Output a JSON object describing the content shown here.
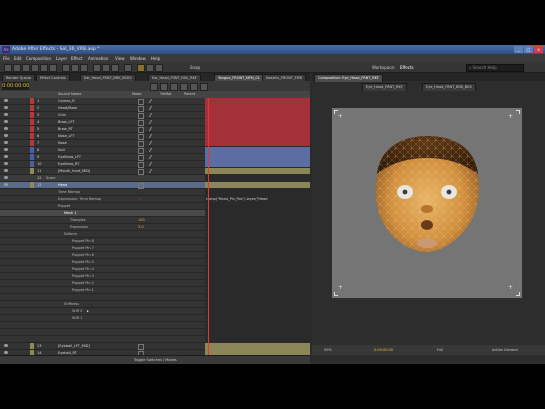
{
  "window": {
    "title": "Adobe After Effects - Sol_36_VRB.aep *"
  },
  "menu": [
    "File",
    "Edit",
    "Composition",
    "Layer",
    "Effect",
    "Animation",
    "View",
    "Window",
    "Help"
  ],
  "toolbar": {
    "snapping_label": "Snap",
    "workspace_label": "Workspace:",
    "workspace_value": "Effects",
    "search_placeholder": "Search Help"
  },
  "timeline": {
    "tabs": [
      "Render Queue",
      "Effect Controls",
      "Ear_Head_FRNT_BRK_BCKS",
      "Ear_Head_FRNT_RHL_RKF",
      "Tongue_FRONT_MFN_01",
      "Nostrils_FRONT_FMR"
    ],
    "timecode": "0:00:00:00",
    "columns": {
      "source_name": "Source Name",
      "mode": "Mode",
      "track": "TrkMat",
      "parent": "Parent"
    },
    "layers": [
      {
        "num": "1",
        "name": "Cornea_R"
      },
      {
        "num": "2",
        "name": "Head/Mask"
      },
      {
        "num": "3",
        "name": "Chin"
      },
      {
        "num": "4",
        "name": "Brow_LFT"
      },
      {
        "num": "5",
        "name": "Brow_RT"
      },
      {
        "num": "6",
        "name": "Nose_LFT"
      },
      {
        "num": "7",
        "name": "Nose"
      },
      {
        "num": "8",
        "name": "Null"
      },
      {
        "num": "9",
        "name": "EyeBrow_LFT"
      },
      {
        "num": "10",
        "name": "EyeBrow_RT"
      },
      {
        "num": "11",
        "name": "[Mouth_front_MID]"
      },
      {
        "num": "12",
        "name": "Head"
      }
    ],
    "properties": [
      {
        "label": "Scale"
      },
      {
        "label": "Time Remap"
      },
      {
        "label": "Expression: Time Remap"
      },
      {
        "label": "Puppet"
      },
      {
        "label": "Mesh 1"
      },
      {
        "label": "Triangles",
        "value": "100"
      },
      {
        "label": "Expansion",
        "value": "3.0"
      },
      {
        "label": "Deform"
      },
      {
        "label": "Puppet Pin 8"
      },
      {
        "label": "Puppet Pin 7"
      },
      {
        "label": "Puppet Pin 6"
      },
      {
        "label": "Puppet Pin 5"
      },
      {
        "label": "Puppet Pin 4"
      },
      {
        "label": "Puppet Pin 3"
      },
      {
        "label": "Puppet Pin 2"
      },
      {
        "label": "Puppet Pin 1"
      },
      {
        "label": "Stiffness"
      },
      {
        "label": "Stiff 2"
      },
      {
        "label": "Stiff 1"
      }
    ],
    "bottom_layers": [
      {
        "num": "13",
        "name": "[Eyeball_LFT_MID]"
      },
      {
        "num": "14",
        "name": "Eyeball_RT"
      }
    ],
    "expression_text": "comp(\"Head_Pin_Pos\").layer(\"Head",
    "footer_label": "Toggle Switches / Modes"
  },
  "viewer": {
    "tab": "Composition: Eye_Head_FRNT_RKF",
    "breadcrumbs": [
      "Eye_Head_FRNT_RKF",
      "Eye_Head_FRNT_BRK_BKS"
    ],
    "zoom": "50%",
    "timecode": "0:00:00:00",
    "resolution": "Full",
    "camera": "Active Camera"
  }
}
